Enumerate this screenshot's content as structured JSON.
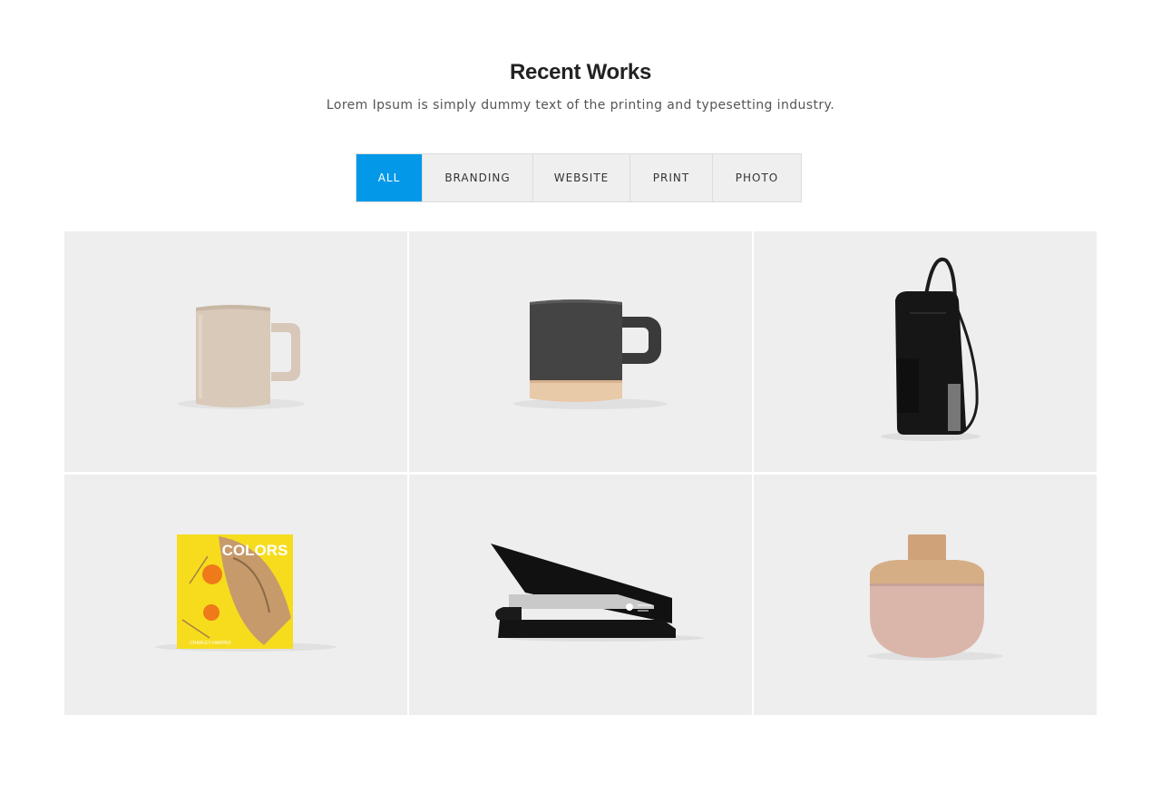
{
  "section": {
    "title": "Recent Works",
    "subtitle": "Lorem Ipsum is simply dummy text of the printing and typesetting industry."
  },
  "filters": [
    {
      "label": "ALL",
      "active": true
    },
    {
      "label": "BRANDING",
      "active": false
    },
    {
      "label": "WEBSITE",
      "active": false
    },
    {
      "label": "PRINT",
      "active": false
    },
    {
      "label": "PHOTO",
      "active": false
    }
  ],
  "portfolio": {
    "items": [
      {
        "icon": "beige-mug-icon"
      },
      {
        "icon": "dark-mug-icon"
      },
      {
        "icon": "backpack-icon"
      },
      {
        "icon": "colors-book-icon",
        "cover_title": "COLORS",
        "cover_author": "CHARLEY HARPER"
      },
      {
        "icon": "stapler-icon"
      },
      {
        "icon": "cork-vase-icon"
      }
    ]
  },
  "colors": {
    "accent": "#0399e8",
    "tile_background": "#eeeeee",
    "filter_background": "#efefef"
  }
}
